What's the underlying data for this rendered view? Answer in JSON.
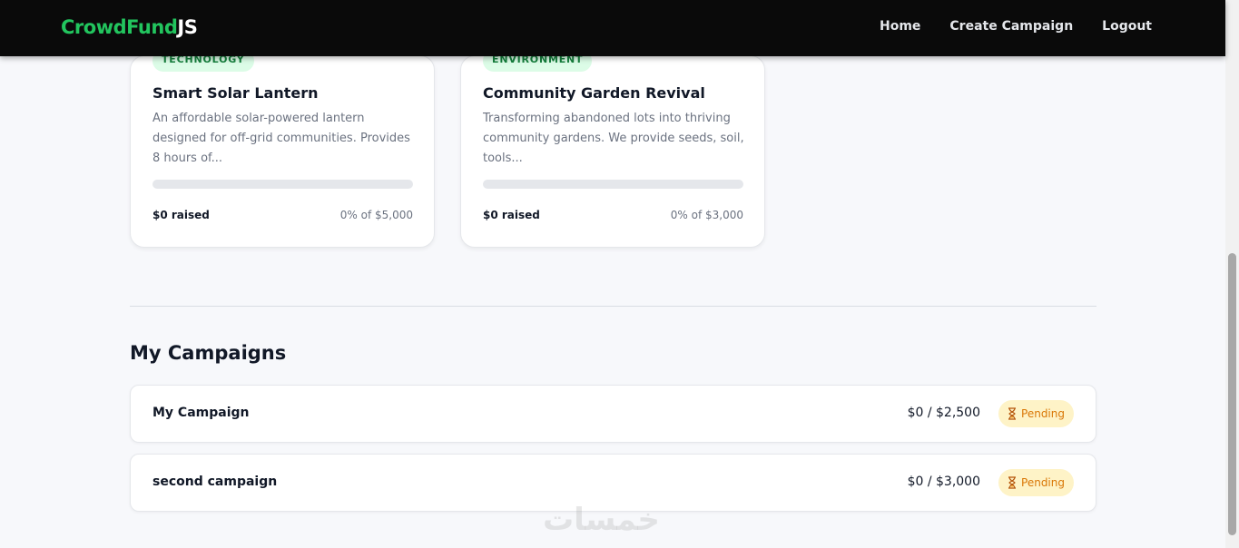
{
  "nav": {
    "brand_part1": "CrowdFund",
    "brand_part2": "JS",
    "links": [
      "Home",
      "Create Campaign",
      "Logout"
    ]
  },
  "featured": [
    {
      "category": "TECHNOLOGY",
      "title": "Smart Solar Lantern",
      "description": "An affordable solar-powered lantern designed for off-grid communities. Provides 8 hours of...",
      "progress": 0,
      "raised": "$0 raised",
      "percent_text": "0% of $5,000"
    },
    {
      "category": "ENVIRONMENT",
      "title": "Community Garden Revival",
      "description": "Transforming abandoned lots into thriving community gardens. We provide seeds, soil, tools...",
      "progress": 0,
      "raised": "$0 raised",
      "percent_text": "0% of $3,000"
    }
  ],
  "my_campaigns": {
    "title": "My Campaigns",
    "items": [
      {
        "name": "My Campaign",
        "amount": "$0 / $2,500",
        "status": "Pending"
      },
      {
        "name": "second campaign",
        "amount": "$0 / $3,000",
        "status": "Pending"
      }
    ]
  },
  "watermark": "خمسات",
  "colors": {
    "accent": "#22c55e",
    "navbar": "#0a0a0a",
    "pending_bg": "#fef3c7",
    "pending_text": "#d97706",
    "tag_bg": "#dcfce7",
    "tag_text": "#15803d"
  }
}
